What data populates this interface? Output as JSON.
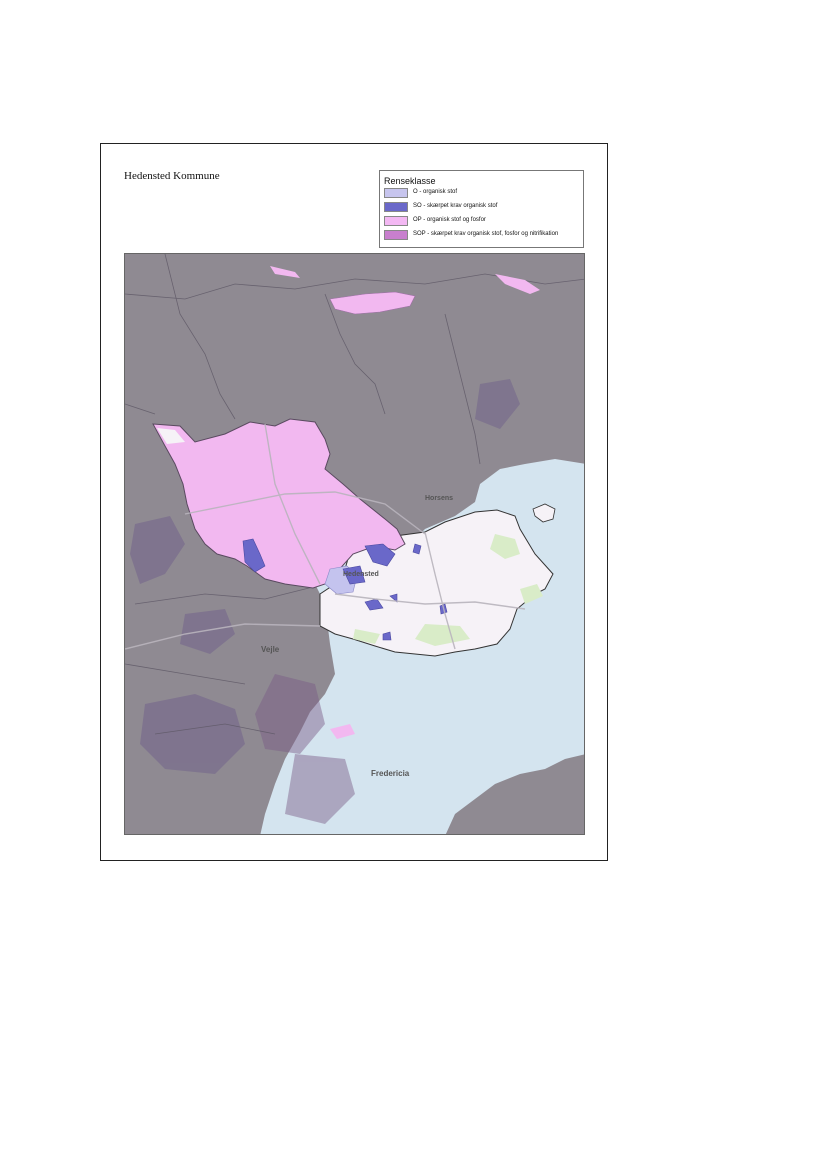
{
  "page": {
    "title": "Hedensted Kommune"
  },
  "legend": {
    "heading": "Renseklasse",
    "items": [
      {
        "label": "O - organisk stof",
        "color": "#c7c5ee"
      },
      {
        "label": "SO - skærpet krav organisk stof",
        "color": "#6a68c9"
      },
      {
        "label": "OP - organisk stof og fosfor",
        "color": "#f3b8f3"
      },
      {
        "label": "SOP - skærpet krav organisk stof, fosfor og nitrifikation",
        "color": "#c87fce"
      }
    ]
  },
  "map": {
    "place_labels": [
      "Vejle",
      "Hedensted",
      "Fredericia",
      "Horsens"
    ],
    "colors": {
      "water": "#d4e4ef",
      "land_outside": "#8f8a92",
      "municipality_fill": "#f6f2f7",
      "op_area": "#f2b8f0",
      "so_area": "#6a68c9",
      "o_area": "#c4c3ee",
      "green": "#d9ecc8"
    }
  }
}
